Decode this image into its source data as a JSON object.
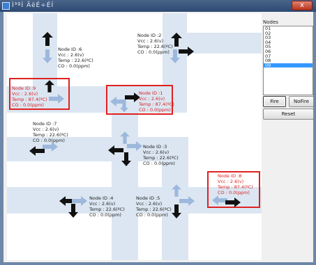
{
  "window": {
    "title": "Ì³ºÌ ÃëÉ÷ÉÍ",
    "close_label": "x"
  },
  "nodes_panel": {
    "label": "Nodes",
    "items": [
      "01",
      "02",
      "03",
      "04",
      "05",
      "06",
      "07",
      "08",
      "09"
    ],
    "selected_index": 8
  },
  "buttons": {
    "fire": "Fire",
    "nofire": "NoFire",
    "reset": "Reset"
  },
  "sensor_nodes": [
    {
      "id_label": "Node ID :1",
      "vcc": "Vcc : 2.6(v)",
      "temp": "Temp : 87.4(ºC)",
      "co": "CO : 0.0(ppm)",
      "fire": true
    },
    {
      "id_label": "Node ID :2",
      "vcc": "Vcc : 2.6(v)",
      "temp": "Temp : 22.6(ºC)",
      "co": "CO : 0.0(ppm)",
      "fire": false
    },
    {
      "id_label": "Node ID :3",
      "vcc": "Vcc : 2.6(v)",
      "temp": "Temp : 22.6(ºC)",
      "co": "CO : 0.0(ppm)",
      "fire": false
    },
    {
      "id_label": "Node ID :4",
      "vcc": "Vcc : 2.6(v)",
      "temp": "Temp : 22.6(ºC)",
      "co": "CO : 0.0(ppm)",
      "fire": false
    },
    {
      "id_label": "Node ID :5",
      "vcc": "Vcc : 2.6(v)",
      "temp": "Temp : 22.6(ºC)",
      "co": "CO : 0.0(ppm)",
      "fire": false
    },
    {
      "id_label": "Node ID :6",
      "vcc": "Vcc : 2.6(v)",
      "temp": "Temp : 22.6(ºC)",
      "co": "CO : 0.0(ppm)",
      "fire": false
    },
    {
      "id_label": "Node ID :7",
      "vcc": "Vcc : 2.6(v)",
      "temp": "Temp : 22.6(ºC)",
      "co": "CO : 0.0(ppm)",
      "fire": false
    },
    {
      "id_label": "Node ID :8",
      "vcc": "Vcc : 2.6(v)",
      "temp": "Temp : 87.4(ºC)",
      "co": "CO : 0.0(ppm)",
      "fire": true
    },
    {
      "id_label": "Node ID :9",
      "vcc": "Vcc : 2.6(v)",
      "temp": "Temp : 87.4(ºC)",
      "co": "CO : 0.0(ppm)",
      "fire": true
    }
  ],
  "colors": {
    "fire_text": "#e02020",
    "road": "#dbe6f2",
    "arrow_dark": "#111111",
    "arrow_light": "#9db8dc",
    "selection": "#3399ff"
  }
}
